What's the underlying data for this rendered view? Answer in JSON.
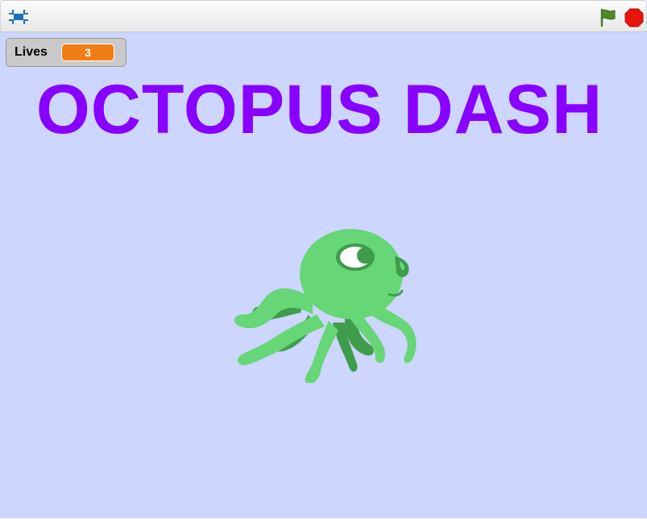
{
  "toolbar": {
    "fullscreen_icon": "fullscreen-icon",
    "green_flag_icon": "green-flag-icon",
    "stop_icon": "stop-sign-icon"
  },
  "stage": {
    "background_color": "#ccd6ff",
    "monitor": {
      "label": "Lives",
      "value": "3",
      "value_color": "#f07d17"
    },
    "title": "OCTOPUS DASH",
    "title_color": "#8800ff",
    "sprite": "octopus"
  }
}
